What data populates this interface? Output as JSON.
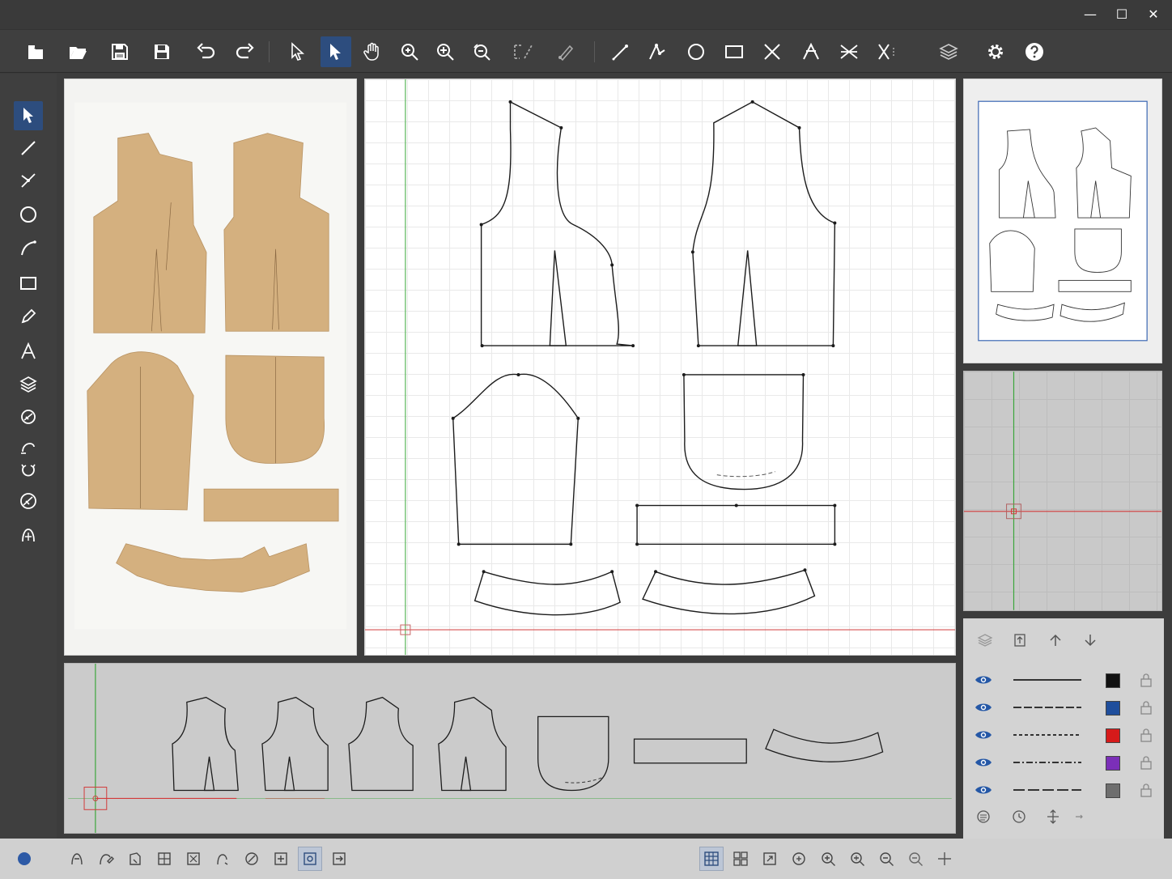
{
  "window": {
    "controls": {
      "minimize": "—",
      "maximize": "☐",
      "close": "✕"
    }
  },
  "toolbar": {
    "buttons": [
      {
        "name": "new-file",
        "icon": "new-file-icon"
      },
      {
        "name": "open-folder",
        "icon": "open-folder-icon"
      },
      {
        "name": "save-as",
        "icon": "save-as-icon"
      },
      {
        "name": "save",
        "icon": "save-icon"
      },
      {
        "name": "undo",
        "icon": "undo-icon"
      },
      {
        "name": "redo",
        "icon": "redo-icon"
      },
      {
        "name": "select-outline",
        "icon": "pointer-outline-icon"
      },
      {
        "name": "select",
        "icon": "pointer-icon",
        "active": true
      },
      {
        "name": "pan",
        "icon": "hand-icon"
      },
      {
        "name": "zoom-in",
        "icon": "zoom-in-icon"
      },
      {
        "name": "zoom-fit",
        "icon": "zoom-plus-icon"
      },
      {
        "name": "zoom-reset",
        "icon": "zoom-reset-icon"
      },
      {
        "name": "measure",
        "icon": "measure-icon"
      },
      {
        "name": "pen-node",
        "icon": "pen-node-icon"
      },
      {
        "name": "line",
        "icon": "line-icon"
      },
      {
        "name": "polyline",
        "icon": "polyline-icon"
      },
      {
        "name": "circle",
        "icon": "circle-icon"
      },
      {
        "name": "rectangle",
        "icon": "rectangle-icon"
      },
      {
        "name": "cross",
        "icon": "cross-icon"
      },
      {
        "name": "dart",
        "icon": "dart-icon"
      },
      {
        "name": "mirror",
        "icon": "mirror-icon"
      },
      {
        "name": "notch",
        "icon": "notch-icon"
      },
      {
        "name": "layers",
        "icon": "layers-icon"
      },
      {
        "name": "settings",
        "icon": "gear-icon"
      },
      {
        "name": "help",
        "icon": "help-icon"
      }
    ]
  },
  "left_tools": [
    {
      "name": "select",
      "icon": "pointer-icon",
      "active": true
    },
    {
      "name": "line",
      "icon": "line-icon"
    },
    {
      "name": "node",
      "icon": "node-icon"
    },
    {
      "name": "circle",
      "icon": "circle-icon"
    },
    {
      "name": "curve",
      "icon": "curve-icon"
    },
    {
      "name": "rectangle",
      "icon": "rectangle-icon"
    },
    {
      "name": "pen",
      "icon": "pen-icon"
    },
    {
      "name": "text",
      "icon": "text-icon",
      "glyph": "A"
    },
    {
      "name": "layers",
      "icon": "layers-icon"
    },
    {
      "name": "grade",
      "icon": "grade-icon"
    },
    {
      "name": "seam",
      "icon": "seam-icon"
    },
    {
      "name": "rotate",
      "icon": "rotate-icon"
    },
    {
      "name": "measure",
      "icon": "measure-circle-icon"
    },
    {
      "name": "fit",
      "icon": "fit-icon"
    }
  ],
  "layers": [
    {
      "style": "solid",
      "color": "#111111"
    },
    {
      "style": "dash",
      "color": "#1f4e9c"
    },
    {
      "style": "dot",
      "color": "#d61a1a"
    },
    {
      "style": "dashdot",
      "color": "#7b2fb8"
    },
    {
      "style": "longdash",
      "color": "#6e6e6e"
    }
  ],
  "colors": {
    "accent": "#2d4d7e",
    "eye": "#2457a6",
    "guide_green": "#3aa63a",
    "guide_red": "#d23a3a",
    "kraft": "#d6b383"
  },
  "statusbar": {
    "left_tools": [
      "pattern-icon",
      "pattern-edit-icon",
      "pattern-rotate-icon",
      "pattern-grid-icon",
      "pattern-node-icon",
      "pattern-curve-icon",
      "pattern-pen-icon",
      "pattern-add-icon",
      "pattern-target-icon",
      "pattern-export-icon"
    ],
    "right_tools": [
      "grid-icon",
      "grid-alt-icon",
      "snap-icon",
      "zoom-area-icon",
      "zoom-in-icon",
      "zoom-page-icon",
      "zoom-all-icon",
      "zoom-out-icon",
      "crosshair-icon"
    ]
  }
}
